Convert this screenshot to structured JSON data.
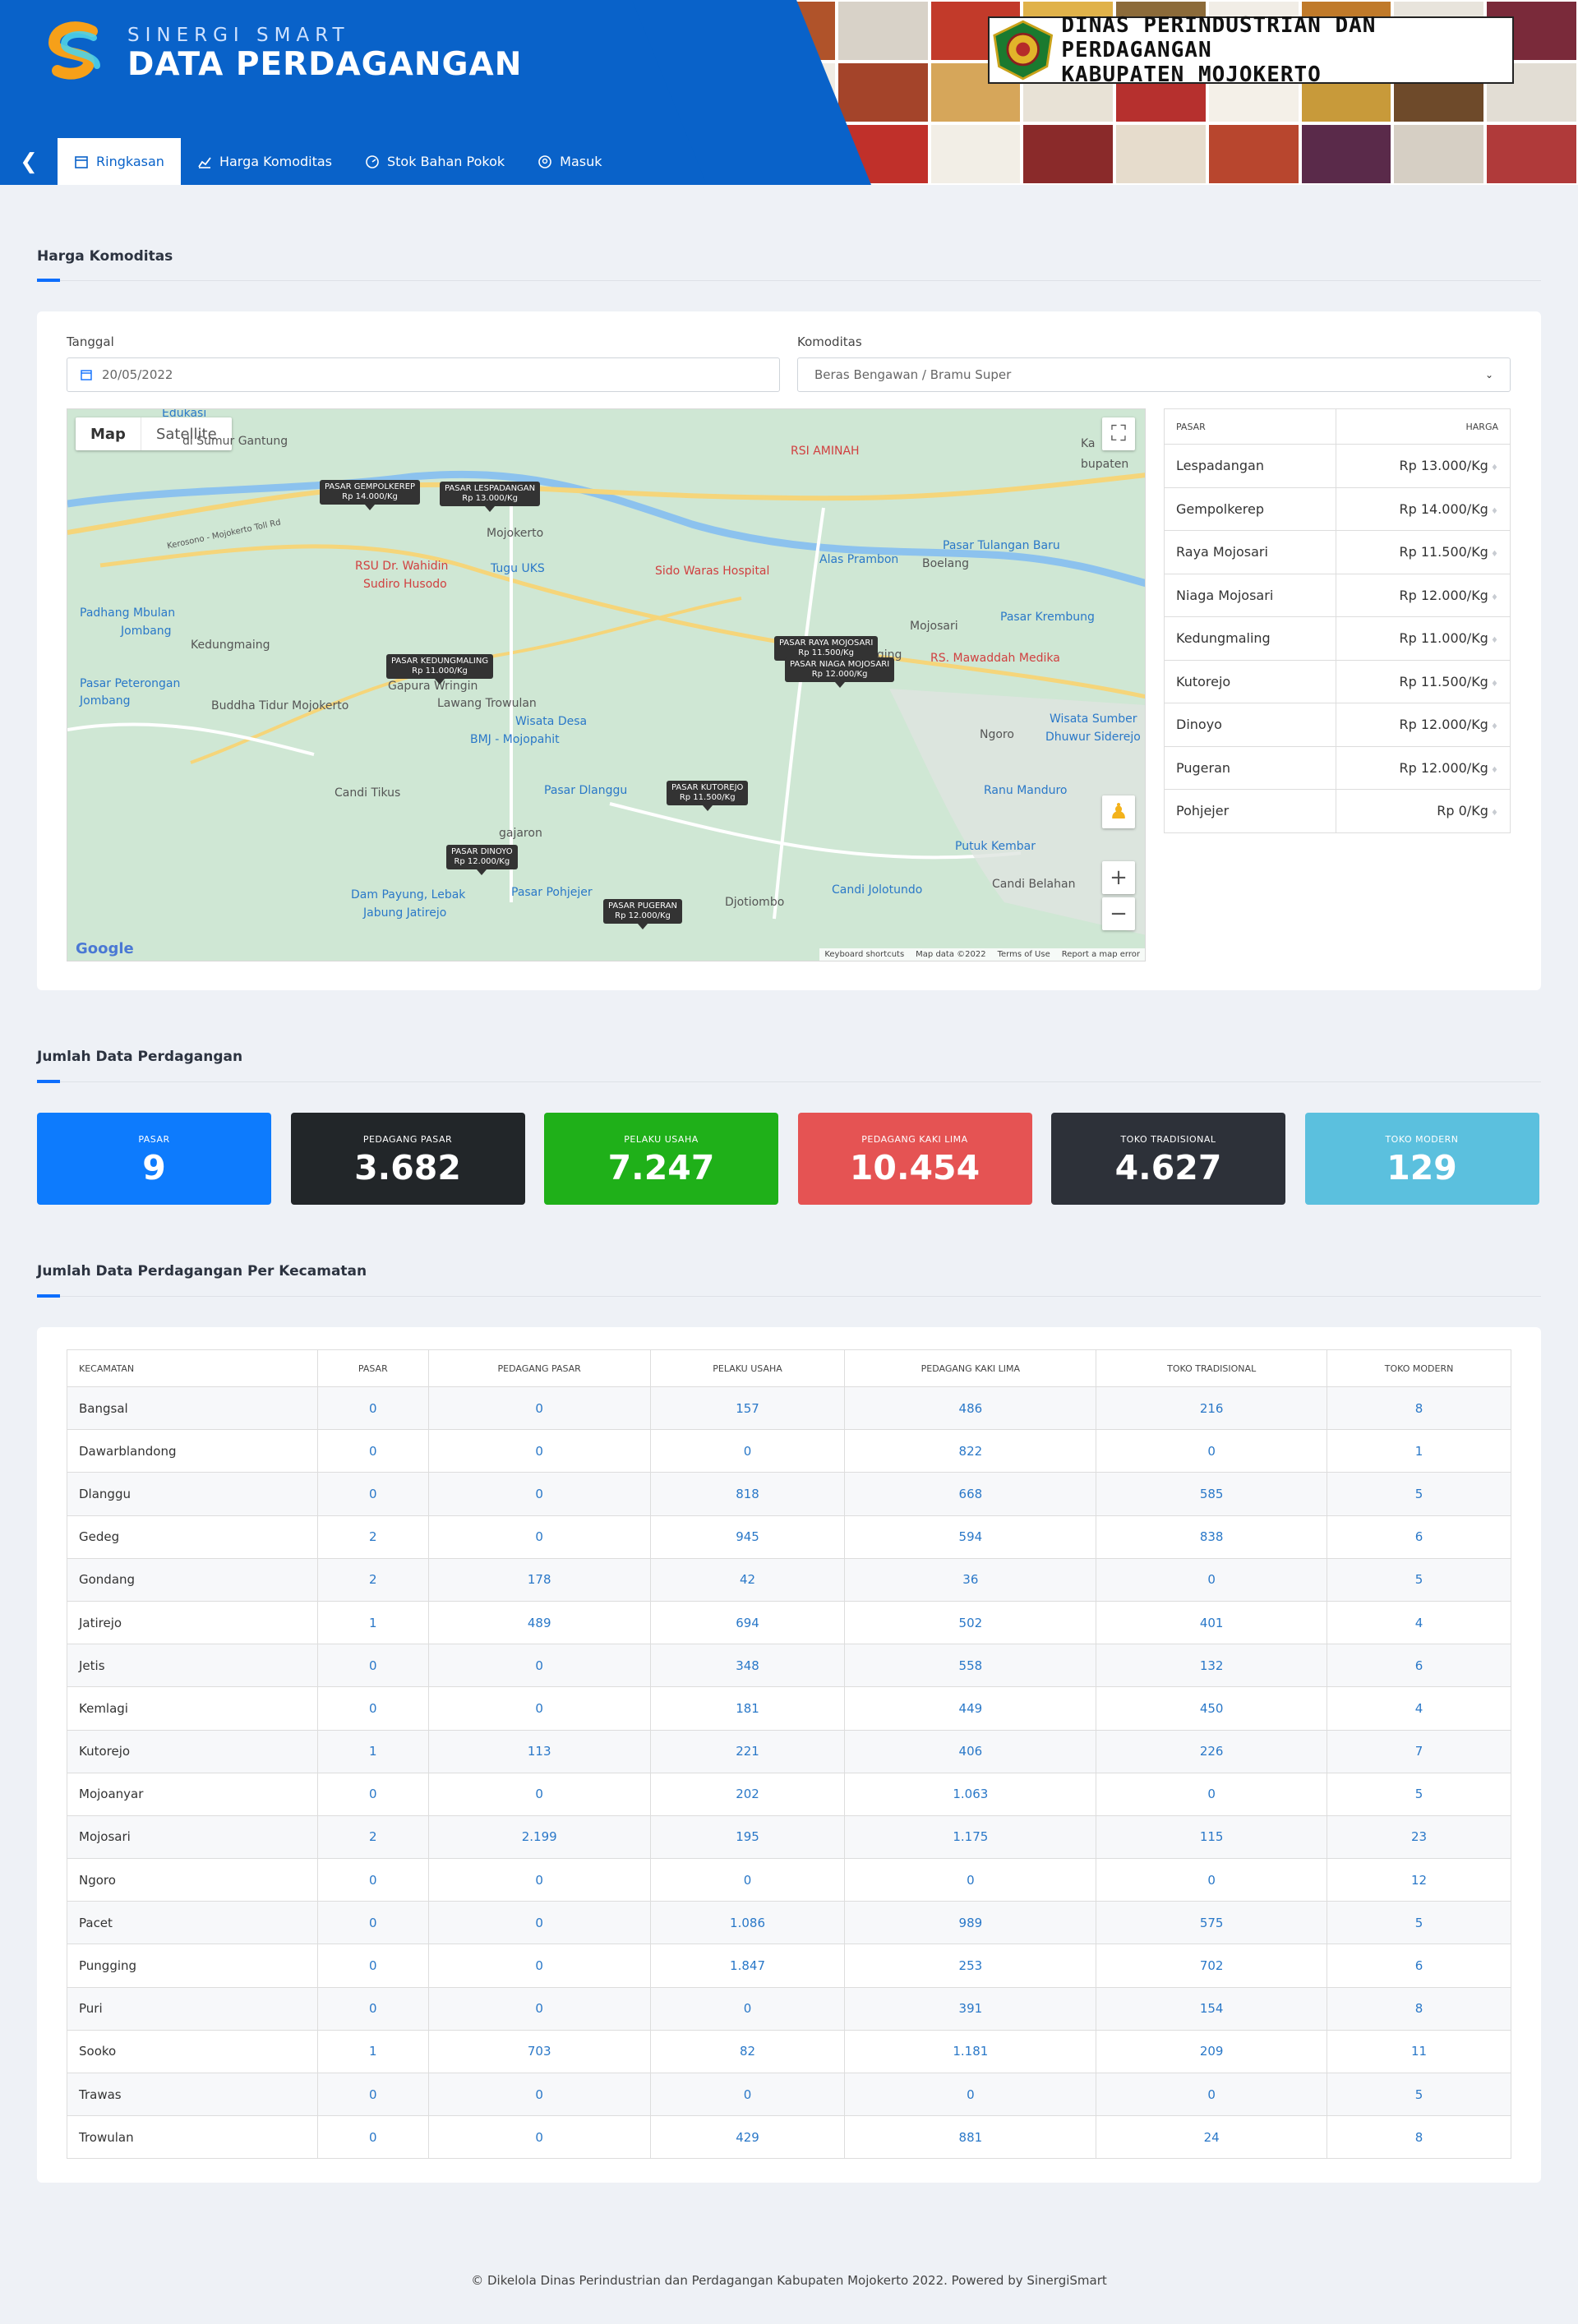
{
  "header": {
    "brand_top": "SINERGI SMART",
    "brand_main": "DATA PERDAGANGAN",
    "dinas_line1": "DINAS PERINDUSTRIAN DAN PERDAGANGAN",
    "dinas_line2": "KABUPATEN MOJOKERTO"
  },
  "nav": [
    {
      "label": "Ringkasan",
      "icon": "calendar-icon",
      "active": true
    },
    {
      "label": "Harga Komoditas",
      "icon": "chart-icon",
      "active": false
    },
    {
      "label": "Stok Bahan Pokok",
      "icon": "gauge-icon",
      "active": false
    },
    {
      "label": "Masuk",
      "icon": "login-icon",
      "active": false
    }
  ],
  "harga": {
    "section_title": "Harga Komoditas",
    "tanggal_label": "Tanggal",
    "tanggal_value": "20/05/2022",
    "komoditas_label": "Komoditas",
    "komoditas_value": "Beras Bengawan / Bramu Super"
  },
  "map": {
    "tab_map": "Map",
    "tab_satellite": "Satellite",
    "footer_shortcuts": "Keyboard shortcuts",
    "footer_data": "Map data ©2022",
    "footer_terms": "Terms of Use",
    "footer_report": "Report a map error",
    "google": "Google",
    "places": [
      {
        "text": "Edukasi",
        "kind": "blue"
      },
      {
        "text": "di Sumur Gantung",
        "kind": "grey"
      },
      {
        "text": "RSI AMINAH",
        "kind": "red"
      },
      {
        "text": "Ka",
        "kind": "grey"
      },
      {
        "text": "bupaten",
        "kind": "grey"
      },
      {
        "text": "Mojokerto",
        "kind": "grey"
      },
      {
        "text": "Pasar Tulangan Baru",
        "kind": "blue"
      },
      {
        "text": "Alas Prambon",
        "kind": "blue"
      },
      {
        "text": "Boelang",
        "kind": "grey"
      },
      {
        "text": "RSU Dr. Wahidin",
        "kind": "red"
      },
      {
        "text": "Sudiro Husodo",
        "kind": "red"
      },
      {
        "text": "Tugu UKS",
        "kind": "blue"
      },
      {
        "text": "Sido Waras Hospital",
        "kind": "red"
      },
      {
        "text": "Padhang Mbulan",
        "kind": "blue"
      },
      {
        "text": "Jombang",
        "kind": "blue"
      },
      {
        "text": "Pasar Krembung",
        "kind": "blue"
      },
      {
        "text": "Kedungmaing",
        "kind": "grey"
      },
      {
        "text": "Mojosari",
        "kind": "grey"
      },
      {
        "text": "Pungging",
        "kind": "grey"
      },
      {
        "text": "RS. Mawaddah Medika",
        "kind": "red"
      },
      {
        "text": "Pasar Peterongan",
        "kind": "blue"
      },
      {
        "text": "Jombang",
        "kind": "blue"
      },
      {
        "text": "Gapura Wringin",
        "kind": "grey"
      },
      {
        "text": "Lawang Trowulan",
        "kind": "grey"
      },
      {
        "text": "Buddha Tidur Mojokerto",
        "kind": "grey"
      },
      {
        "text": "Wisata Desa",
        "kind": "blue"
      },
      {
        "text": "BMJ - Mojopahit",
        "kind": "blue"
      },
      {
        "text": "Ngoro",
        "kind": "grey"
      },
      {
        "text": "Wisata Sumber",
        "kind": "blue"
      },
      {
        "text": "Dhuwur Siderejo",
        "kind": "blue"
      },
      {
        "text": "Pasar Dlanggu",
        "kind": "blue"
      },
      {
        "text": "Candi Tikus",
        "kind": "grey"
      },
      {
        "text": "Ranu Manduro",
        "kind": "blue"
      },
      {
        "text": "Putuk Kembar",
        "kind": "blue"
      },
      {
        "text": "Candi Belahan",
        "kind": "grey"
      },
      {
        "text": "Dam Payung, Lebak",
        "kind": "blue"
      },
      {
        "text": "Jabung Jatirejo",
        "kind": "blue"
      },
      {
        "text": "Pasar Pohjejer",
        "kind": "blue"
      },
      {
        "text": "Djotiombo",
        "kind": "grey"
      },
      {
        "text": "Candi Jolotundo",
        "kind": "blue"
      },
      {
        "text": "Kerosono - Mojokerto Toll Rd",
        "kind": "grey"
      },
      {
        "text": "gajaron",
        "kind": "grey"
      }
    ],
    "markers": [
      {
        "name": "PASAR GEMPOLKEREP",
        "price": "Rp 14.000/Kg"
      },
      {
        "name": "PASAR LESPADANGAN",
        "price": "Rp 13.000/Kg"
      },
      {
        "name": "PASAR KEDUNGMALING",
        "price": "Rp 11.000/Kg"
      },
      {
        "name": "PASAR RAYA MOJOSARI",
        "price": "Rp 11.500/Kg"
      },
      {
        "name": "PASAR NIAGA MOJOSARI",
        "price": "Rp 12.000/Kg"
      },
      {
        "name": "PASAR KUTOREJO",
        "price": "Rp 11.500/Kg"
      },
      {
        "name": "PASAR DINOYO",
        "price": "Rp 12.000/Kg"
      },
      {
        "name": "PASAR PUGERAN",
        "price": "Rp 12.000/Kg"
      }
    ]
  },
  "price_table": {
    "col_pasar": "PASAR",
    "col_harga": "HARGA",
    "rows": [
      {
        "pasar": "Lespadangan",
        "harga": "Rp 13.000/Kg"
      },
      {
        "pasar": "Gempolkerep",
        "harga": "Rp 14.000/Kg"
      },
      {
        "pasar": "Raya Mojosari",
        "harga": "Rp 11.500/Kg"
      },
      {
        "pasar": "Niaga Mojosari",
        "harga": "Rp 12.000/Kg"
      },
      {
        "pasar": "Kedungmaling",
        "harga": "Rp 11.000/Kg"
      },
      {
        "pasar": "Kutorejo",
        "harga": "Rp 11.500/Kg"
      },
      {
        "pasar": "Dinoyo",
        "harga": "Rp 12.000/Kg"
      },
      {
        "pasar": "Pugeran",
        "harga": "Rp 12.000/Kg"
      },
      {
        "pasar": "Pohjejer",
        "harga": "Rp 0/Kg"
      }
    ]
  },
  "jumlah": {
    "section_title": "Jumlah Data Perdagangan",
    "stats": [
      {
        "label": "PASAR",
        "value": "9",
        "color": "#0d7bfd"
      },
      {
        "label": "PEDAGANG PASAR",
        "value": "3.682",
        "color": "#222629"
      },
      {
        "label": "PELAKU USAHA",
        "value": "7.247",
        "color": "#1fb019"
      },
      {
        "label": "PEDAGANG KAKI LIMA",
        "value": "10.454",
        "color": "#e55353"
      },
      {
        "label": "TOKO TRADISIONAL",
        "value": "4.627",
        "color": "#2d3139"
      },
      {
        "label": "TOKO MODERN",
        "value": "129",
        "color": "#5bc0de"
      }
    ]
  },
  "kecamatan": {
    "section_title": "Jumlah Data Perdagangan Per Kecamatan",
    "headers": [
      "KECAMATAN",
      "PASAR",
      "PEDAGANG PASAR",
      "PELAKU USAHA",
      "PEDAGANG KAKI LIMA",
      "TOKO TRADISIONAL",
      "TOKO MODERN"
    ],
    "rows": [
      [
        "Bangsal",
        "0",
        "0",
        "157",
        "486",
        "216",
        "8"
      ],
      [
        "Dawarblandong",
        "0",
        "0",
        "0",
        "822",
        "0",
        "1"
      ],
      [
        "Dlanggu",
        "0",
        "0",
        "818",
        "668",
        "585",
        "5"
      ],
      [
        "Gedeg",
        "2",
        "0",
        "945",
        "594",
        "838",
        "6"
      ],
      [
        "Gondang",
        "2",
        "178",
        "42",
        "36",
        "0",
        "5"
      ],
      [
        "Jatirejo",
        "1",
        "489",
        "694",
        "502",
        "401",
        "4"
      ],
      [
        "Jetis",
        "0",
        "0",
        "348",
        "558",
        "132",
        "6"
      ],
      [
        "Kemlagi",
        "0",
        "0",
        "181",
        "449",
        "450",
        "4"
      ],
      [
        "Kutorejo",
        "1",
        "113",
        "221",
        "406",
        "226",
        "7"
      ],
      [
        "Mojoanyar",
        "0",
        "0",
        "202",
        "1.063",
        "0",
        "5"
      ],
      [
        "Mojosari",
        "2",
        "2.199",
        "195",
        "1.175",
        "115",
        "23"
      ],
      [
        "Ngoro",
        "0",
        "0",
        "0",
        "0",
        "0",
        "12"
      ],
      [
        "Pacet",
        "0",
        "0",
        "1.086",
        "989",
        "575",
        "5"
      ],
      [
        "Pungging",
        "0",
        "0",
        "1.847",
        "253",
        "702",
        "6"
      ],
      [
        "Puri",
        "0",
        "0",
        "0",
        "391",
        "154",
        "8"
      ],
      [
        "Sooko",
        "1",
        "703",
        "82",
        "1.181",
        "209",
        "11"
      ],
      [
        "Trawas",
        "0",
        "0",
        "0",
        "0",
        "0",
        "5"
      ],
      [
        "Trowulan",
        "0",
        "0",
        "429",
        "881",
        "24",
        "8"
      ]
    ]
  },
  "footer": "© Dikelola Dinas Perindustrian dan Perdagangan Kabupaten Mojokerto 2022. Powered by SinergiSmart"
}
